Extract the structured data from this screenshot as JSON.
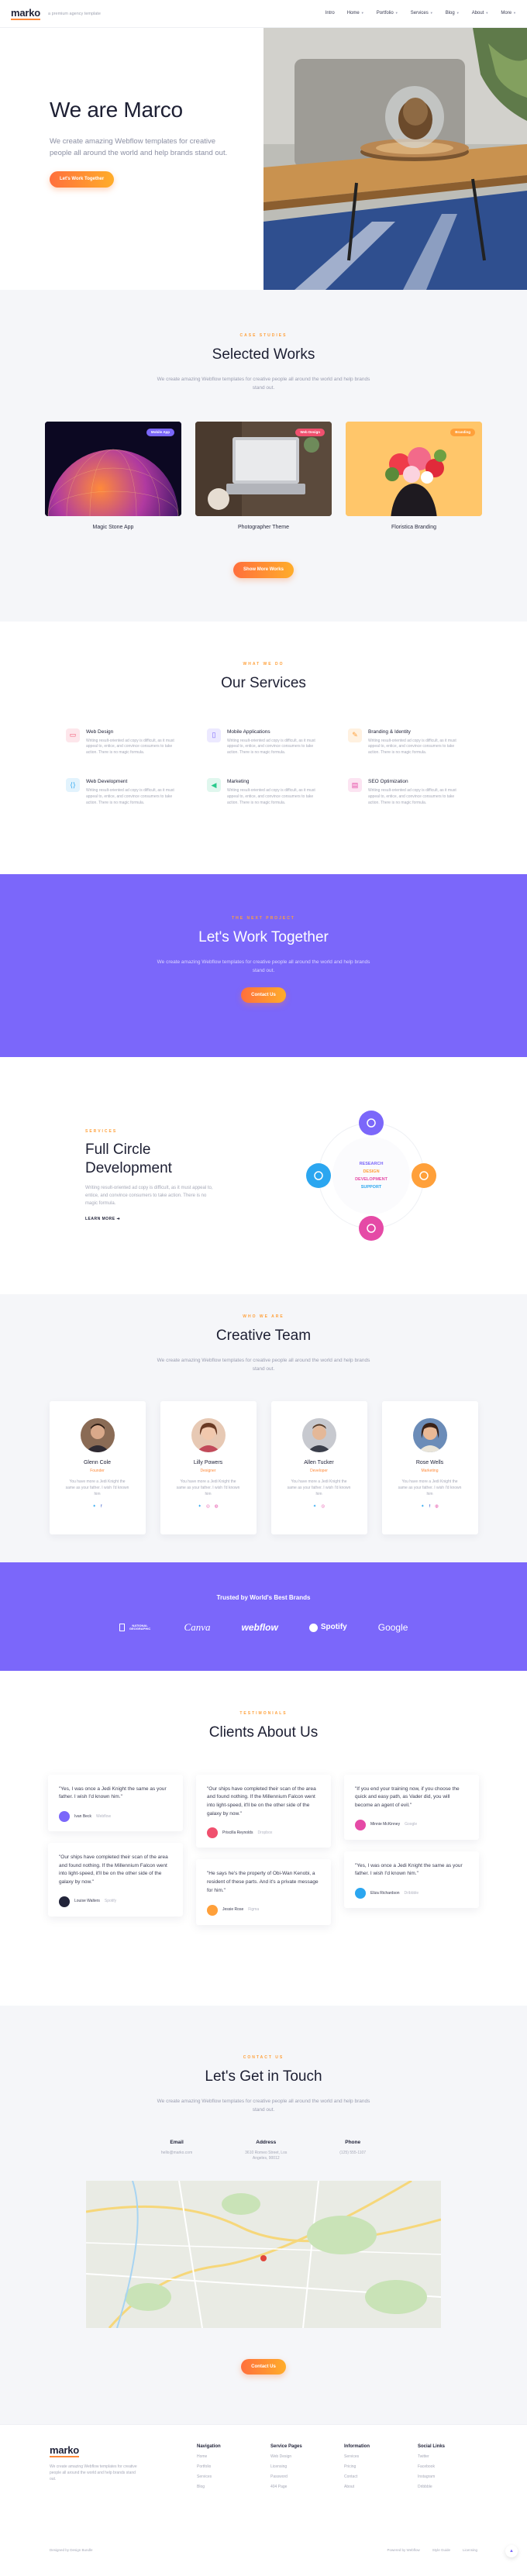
{
  "nav": {
    "logo": "marko",
    "tagline": "a premium agency template",
    "links": [
      "Intro",
      "Home",
      "Portfolio",
      "Services",
      "Blog",
      "About",
      "More"
    ]
  },
  "hero": {
    "title": "We are Marco",
    "subtitle": "We create amazing Webflow templates for creative people all around the world and help brands stand out.",
    "cta": "Let's Work Together"
  },
  "works": {
    "eyebrow": "CASE STUDIES",
    "title": "Selected Works",
    "subtitle": "We create amazing Webflow templates for creative people all around the world and help brands stand out.",
    "items": [
      {
        "title": "Magic Stone App",
        "tag": "Mobile App",
        "tag_color": "#7b67fa"
      },
      {
        "title": "Photographer Theme",
        "tag": "Web Design",
        "tag_color": "#f0506e"
      },
      {
        "title": "Floristica Branding",
        "tag": "Branding",
        "tag_color": "#ffa03a"
      }
    ],
    "cta": "Show More Works"
  },
  "services": {
    "eyebrow": "WHAT WE DO",
    "title": "Our Services",
    "items": [
      {
        "title": "Web Design",
        "text": "Writing result-oriented ad copy is difficult, as it must appeal to, entice, and convince consumers to take action. There is no magic formula.",
        "icon": "monitor-icon",
        "color": "#f0506e"
      },
      {
        "title": "Mobile Applications",
        "text": "Writing result-oriented ad copy is difficult, as it must appeal to, entice, and convince consumers to take action. There is no magic formula.",
        "icon": "phone-icon",
        "color": "#7b67fa"
      },
      {
        "title": "Branding & Identity",
        "text": "Writing result-oriented ad copy is difficult, as it must appeal to, entice, and convince consumers to take action. There is no magic formula.",
        "icon": "pen-icon",
        "color": "#ffa03a"
      },
      {
        "title": "Web Development",
        "text": "Writing result-oriented ad copy is difficult, as it must appeal to, entice, and convince consumers to take action. There is no magic formula.",
        "icon": "code-icon",
        "color": "#2ba6f0"
      },
      {
        "title": "Marketing",
        "text": "Writing result-oriented ad copy is difficult, as it must appeal to, entice, and convince consumers to take action. There is no magic formula.",
        "icon": "megaphone-icon",
        "color": "#28c98b"
      },
      {
        "title": "SEO Optimization",
        "text": "Writing result-oriented ad copy is difficult, as it must appeal to, entice, and convince consumers to take action. There is no magic formula.",
        "icon": "chart-icon",
        "color": "#e54aa6"
      }
    ]
  },
  "together": {
    "eyebrow": "THE NEXT PROJECT",
    "title": "Let's Work Together",
    "subtitle": "We create amazing Webflow templates for creative people all around the world and help brands stand out.",
    "cta": "Contact Us"
  },
  "full": {
    "eyebrow": "SERVICES",
    "title": "Full Circle Development",
    "text": "Writing result-oriented ad copy is difficult, as it must appeal to, entice, and convince consumers to take action. There is no magic formula.",
    "link": "LEARN MORE",
    "orbit": [
      "RESEARCH",
      "DESIGN",
      "DEVELOPMENT",
      "SUPPORT"
    ]
  },
  "team": {
    "eyebrow": "WHO WE ARE",
    "title": "Creative Team",
    "subtitle": "We create amazing Webflow templates for creative people all around the world and help brands stand out.",
    "members": [
      {
        "name": "Glenn Cole",
        "role": "Founder",
        "text": "You have more a Jedi Knight the same as your father. I wish I'd known him"
      },
      {
        "name": "Lilly Powers",
        "role": "Designer",
        "text": "You have more a Jedi Knight the same as your father. I wish I'd known him"
      },
      {
        "name": "Allen Tucker",
        "role": "Developer",
        "text": "You have more a Jedi Knight the same as your father. I wish I'd known him"
      },
      {
        "name": "Rose Wells",
        "role": "Marketing",
        "text": "You have more a Jedi Knight the same as your father. I wish I'd known him"
      }
    ]
  },
  "brands": {
    "title": "Trusted by World's Best Brands",
    "items": [
      "NATIONAL GEOGRAPHIC",
      "Canva",
      "webflow",
      "Spotify",
      "Google"
    ]
  },
  "clients": {
    "eyebrow": "TESTIMONIALS",
    "title": "Clients About Us",
    "cols": [
      [
        {
          "text": "\"Yes, I was once a Jedi Knight the same as your father. I wish I'd known him.\"",
          "name": "Ivan Beck",
          "co": "Webflow",
          "color": "#7b67fa"
        },
        {
          "text": "\"Our ships have completed their scan of the area and found nothing. If the Millennium Falcon went into light-speed, it'll be on the other side of the galaxy by now.\"",
          "name": "Louise Walters",
          "co": "Spotify",
          "color": "#22243a"
        }
      ],
      [
        {
          "text": "\"Our ships have completed their scan of the area and found nothing. If the Millennium Falcon went into light-speed, it'll be on the other side of the galaxy by now.\"",
          "name": "Priscilla Reynolds",
          "co": "Dropbox",
          "color": "#f0506e"
        },
        {
          "text": "\"He says he's the property of Obi-Wan Kenobi, a resident of these parts. And it's a private message for him.\"",
          "name": "Jessie Rose",
          "co": "Figma",
          "color": "#ffa03a"
        }
      ],
      [
        {
          "text": "\"If you end your training now, if you choose the quick and easy path, as Vader did, you will become an agent of evil.\"",
          "name": "Minnie McKinney",
          "co": "Google",
          "color": "#e54aa6"
        },
        {
          "text": "\"Yes, I was once a Jedi Knight the same as your father. I wish I'd known him.\"",
          "name": "Eliza Richardson",
          "co": "Dribbble",
          "color": "#2ba6f0"
        }
      ]
    ]
  },
  "contact": {
    "eyebrow": "CONTACT US",
    "title": "Let's Get in Touch",
    "subtitle": "We create amazing Webflow templates for creative people all around the world and help brands stand out.",
    "cols": [
      {
        "h": "Email",
        "v": "hello@marko.com"
      },
      {
        "h": "Address",
        "v": "3610 Romeo Street, Los Angeles, 90012"
      },
      {
        "h": "Phone",
        "v": "(125) 555-1107"
      }
    ],
    "cta": "Contact Us"
  },
  "footer": {
    "logo": "marko",
    "text": "We create amazing Webflow templates for creative people all around the world and help brands stand out.",
    "cols": [
      {
        "h": "Navigation",
        "items": [
          "Home",
          "Portfolio",
          "Services",
          "Blog"
        ]
      },
      {
        "h": "Service Pages",
        "items": [
          "Web Design",
          "Licensing",
          "Password",
          "404 Page"
        ]
      },
      {
        "h": "Information",
        "items": [
          "Services",
          "Pricing",
          "Contact",
          "About"
        ]
      },
      {
        "h": "Social Links",
        "items": [
          "Twitter",
          "Facebook",
          "Instagram",
          "Dribbble"
        ]
      }
    ],
    "copyright": "Designed by Design Bundle",
    "powered": "Powered by Webflow",
    "style": "Style Guide",
    "lic": "Licensing"
  }
}
